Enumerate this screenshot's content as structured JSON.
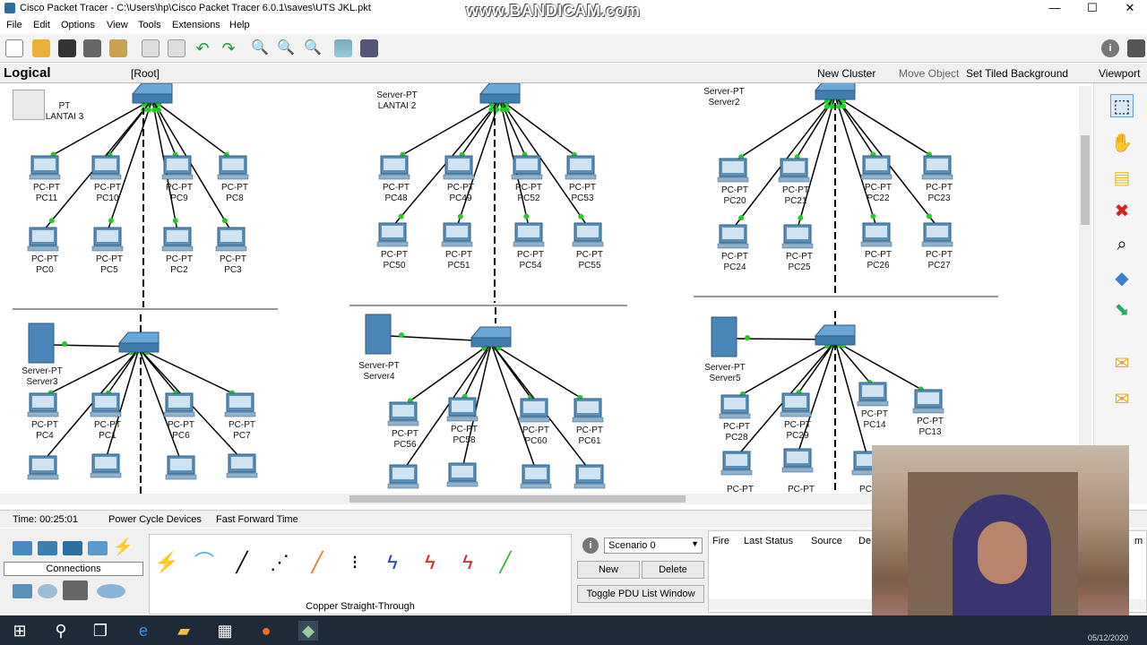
{
  "window": {
    "title": "Cisco Packet Tracer - C:\\Users\\hp\\Cisco Packet Tracer 6.0.1\\saves\\UTS JKL.pkt",
    "watermark": "www.BANDICAM.com",
    "minimize_icon": "—",
    "maximize_icon": "☐",
    "close_icon": "✕"
  },
  "menu": [
    "File",
    "Edit",
    "Options",
    "View",
    "Tools",
    "Extensions",
    "Help"
  ],
  "logical_bar": {
    "mode": "Logical",
    "root": "[Root]",
    "new_cluster": "New Cluster",
    "move_object": "Move Object",
    "set_tiled_background": "Set Tiled Background",
    "viewport": "Viewport"
  },
  "workspace": {
    "lans": [
      {
        "server": {
          "label1": "PT",
          "label2": "LANTAI 3"
        },
        "pcs": [
          {
            "type": "PC-PT",
            "name": "PC11"
          },
          {
            "type": "PC-PT",
            "name": "PC10"
          },
          {
            "type": "PC-PT",
            "name": "PC9"
          },
          {
            "type": "PC-PT",
            "name": "PC8"
          },
          {
            "type": "PC-PT",
            "name": "PC0"
          },
          {
            "type": "PC-PT",
            "name": "PC5"
          },
          {
            "type": "PC-PT",
            "name": "PC2"
          },
          {
            "type": "PC-PT",
            "name": "PC3"
          }
        ]
      },
      {
        "server": {
          "label1": "Server-PT",
          "label2": "LANTAI 2"
        },
        "pcs": [
          {
            "type": "PC-PT",
            "name": "PC48"
          },
          {
            "type": "PC-PT",
            "name": "PC49"
          },
          {
            "type": "PC-PT",
            "name": "PC52"
          },
          {
            "type": "PC-PT",
            "name": "PC53"
          },
          {
            "type": "PC-PT",
            "name": "PC50"
          },
          {
            "type": "PC-PT",
            "name": "PC51"
          },
          {
            "type": "PC-PT",
            "name": "PC54"
          },
          {
            "type": "PC-PT",
            "name": "PC55"
          }
        ]
      },
      {
        "server": {
          "label1": "Server-PT",
          "label2": "Server2"
        },
        "pcs": [
          {
            "type": "PC-PT",
            "name": "PC20"
          },
          {
            "type": "PC-PT",
            "name": "PC21"
          },
          {
            "type": "PC-PT",
            "name": "PC22"
          },
          {
            "type": "PC-PT",
            "name": "PC23"
          },
          {
            "type": "PC-PT",
            "name": "PC24"
          },
          {
            "type": "PC-PT",
            "name": "PC25"
          },
          {
            "type": "PC-PT",
            "name": "PC26"
          },
          {
            "type": "PC-PT",
            "name": "PC27"
          }
        ]
      },
      {
        "server": {
          "label1": "Server-PT",
          "label2": "Server3"
        },
        "pcs": [
          {
            "type": "PC-PT",
            "name": "PC4"
          },
          {
            "type": "PC-PT",
            "name": "PC1"
          },
          {
            "type": "PC-PT",
            "name": "PC6"
          },
          {
            "type": "PC-PT",
            "name": "PC7"
          }
        ]
      },
      {
        "server": {
          "label1": "Server-PT",
          "label2": "Server4"
        },
        "pcs": [
          {
            "type": "PC-PT",
            "name": "PC56"
          },
          {
            "type": "PC-PT",
            "name": "PC58"
          },
          {
            "type": "PC-PT",
            "name": "PC60"
          },
          {
            "type": "PC-PT",
            "name": "PC61"
          }
        ]
      },
      {
        "server": {
          "label1": "Server-PT",
          "label2": "Server5"
        },
        "pcs": [
          {
            "type": "PC-PT",
            "name": "PC28"
          },
          {
            "type": "PC-PT",
            "name": "PC29"
          },
          {
            "type": "PC-PT",
            "name": "PC14"
          },
          {
            "type": "PC-PT",
            "name": "PC13"
          }
        ]
      }
    ],
    "bottom_row_labels": [
      "PC-PT",
      "PC-PT",
      "PC"
    ]
  },
  "status": {
    "time": "Time: 00:25:01",
    "power_cycle": "Power Cycle Devices",
    "fast_forward": "Fast Forward Time"
  },
  "device_panel": {
    "category_label": "Connections",
    "selected_connection": "Copper Straight-Through"
  },
  "pdu": {
    "scenario": "Scenario 0",
    "new": "New",
    "delete": "Delete",
    "toggle": "Toggle PDU List Window",
    "columns": [
      "Fire",
      "Last Status",
      "Source",
      "De"
    ],
    "partial_col": "m"
  },
  "taskbar": {
    "date": "05/12/2020"
  },
  "colors": {
    "link_green": "#22cc22",
    "cable": "#000000",
    "pc_blue": "#5a8fb8",
    "switch_blue": "#3f7fb0"
  }
}
